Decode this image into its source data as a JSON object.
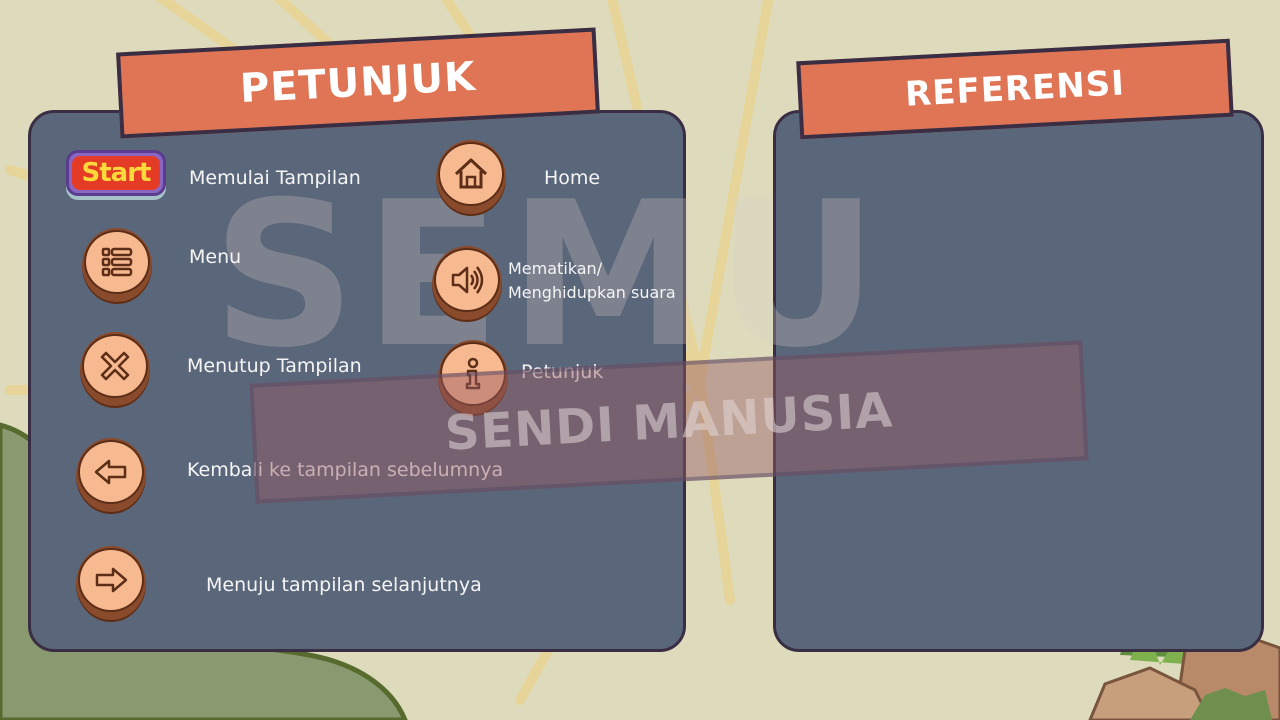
{
  "petunjuk": {
    "title": "PETUNJUK",
    "start_button": "Start",
    "items": [
      {
        "icon": "start-button",
        "label": "Memulai Tampilan"
      },
      {
        "icon": "home-icon",
        "label": "Home"
      },
      {
        "icon": "menu-list-icon",
        "label": "Menu"
      },
      {
        "icon": "speaker-icon",
        "label_line1": "Mematikan/",
        "label_line2": "Menghidupkan suara"
      },
      {
        "icon": "close-x-icon",
        "label": "Menutup Tampilan"
      },
      {
        "icon": "info-icon",
        "label": "Petunjuk"
      },
      {
        "icon": "arrow-left-icon",
        "label": "Kembali ke tampilan sebelumnya"
      },
      {
        "icon": "arrow-right-icon",
        "label": "Menuju tampilan selanjutnya"
      }
    ]
  },
  "referensi": {
    "title": "REFERENSI"
  },
  "watermark": {
    "big_text": "SEMU",
    "band_text": "SENDI MANUSIA"
  },
  "colors": {
    "background": "#dedbbd",
    "panel": "#5a6679",
    "banner": "#e07556",
    "outline": "#3a2e44",
    "button_face": "#f7b98f",
    "button_rim": "#8a4a2c"
  }
}
